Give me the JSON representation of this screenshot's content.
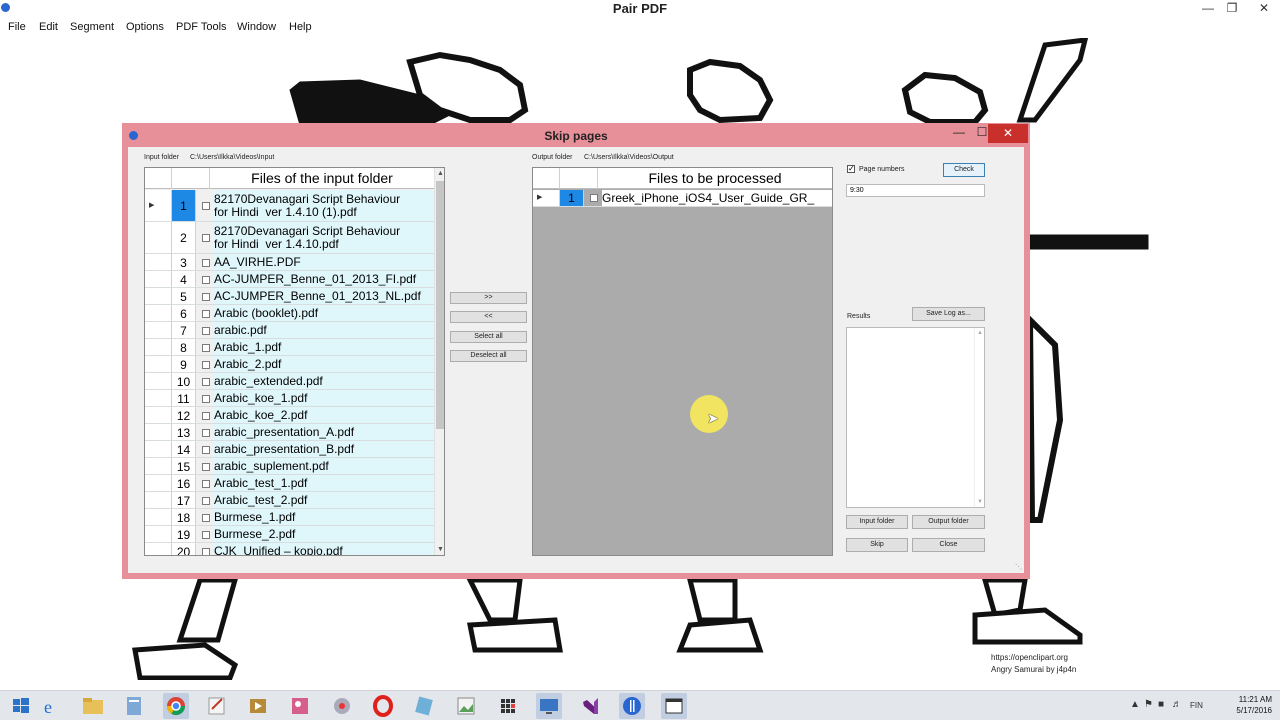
{
  "app": {
    "title": "Pair PDF"
  },
  "menu": [
    "File",
    "Edit",
    "Segment",
    "Options",
    "PDF Tools",
    "Window",
    "Help"
  ],
  "dialog": {
    "title": "Skip pages",
    "input_folder_label": "Input folder",
    "input_folder_path": "C:\\Users\\Ilkka\\Videos\\Input",
    "output_folder_label": "Output folder",
    "output_folder_path": "C:\\Users\\Ilkka\\Videos\\Output",
    "input_grid": {
      "header": "Files of the input folder",
      "rows": [
        {
          "n": "1",
          "name": "82170Devanagari Script Behaviour\nfor Hindi  ver 1.4.10 (1).pdf"
        },
        {
          "n": "2",
          "name": "82170Devanagari Script Behaviour\nfor Hindi  ver 1.4.10.pdf"
        },
        {
          "n": "3",
          "name": "AA_VIRHE.PDF"
        },
        {
          "n": "4",
          "name": "AC-JUMPER_Benne_01_2013_FI.pdf"
        },
        {
          "n": "5",
          "name": "AC-JUMPER_Benne_01_2013_NL.pdf"
        },
        {
          "n": "6",
          "name": "Arabic (booklet).pdf"
        },
        {
          "n": "7",
          "name": "arabic.pdf"
        },
        {
          "n": "8",
          "name": "Arabic_1.pdf"
        },
        {
          "n": "9",
          "name": "Arabic_2.pdf"
        },
        {
          "n": "10",
          "name": "arabic_extended.pdf"
        },
        {
          "n": "11",
          "name": "Arabic_koe_1.pdf"
        },
        {
          "n": "12",
          "name": "Arabic_koe_2.pdf"
        },
        {
          "n": "13",
          "name": "arabic_presentation_A.pdf"
        },
        {
          "n": "14",
          "name": "arabic_presentation_B.pdf"
        },
        {
          "n": "15",
          "name": "arabic_suplement.pdf"
        },
        {
          "n": "16",
          "name": "Arabic_test_1.pdf"
        },
        {
          "n": "17",
          "name": "Arabic_test_2.pdf"
        },
        {
          "n": "18",
          "name": "Burmese_1.pdf"
        },
        {
          "n": "19",
          "name": "Burmese_2.pdf"
        },
        {
          "n": "20",
          "name": "CJK_Unified – kopio.pdf"
        }
      ]
    },
    "move_right": ">>",
    "move_left": "<<",
    "select_all": "Select all",
    "deselect_all": "Deselect all",
    "output_grid": {
      "header": "Files to be processed",
      "rows": [
        {
          "n": "1",
          "name": "Greek_iPhone_iOS4_User_Guide_GR_"
        }
      ]
    },
    "page_numbers_label": "Page numbers",
    "page_numbers_checked": true,
    "check_button": "Check",
    "page_numbers_value": "9:30",
    "results_label": "Results",
    "save_log_button": "Save Log as...",
    "input_folder_button": "Input folder",
    "output_folder_button": "Output folder",
    "skip_button": "Skip",
    "close_button": "Close"
  },
  "credit": [
    "https://openclipart.org",
    "Angry Samurai by j4p4n"
  ],
  "taskbar": {
    "apps": [
      "start",
      "internet-explorer",
      "file-explorer",
      "notepad",
      "chrome",
      "text-editor",
      "media-player",
      "paint",
      "recorder",
      "opera",
      "notes",
      "photo-viewer",
      "calculator",
      "remote-desktop",
      "visual-studio",
      "pair-pdf",
      "window-app"
    ],
    "lang": "FIN",
    "time": "11:21 AM",
    "date": "5/17/2016"
  },
  "colors": {
    "dialog_frame": "#e8909a",
    "selected_row": "#1e88e5",
    "file_cell": "#dff6fb",
    "close_red": "#c9302c"
  }
}
